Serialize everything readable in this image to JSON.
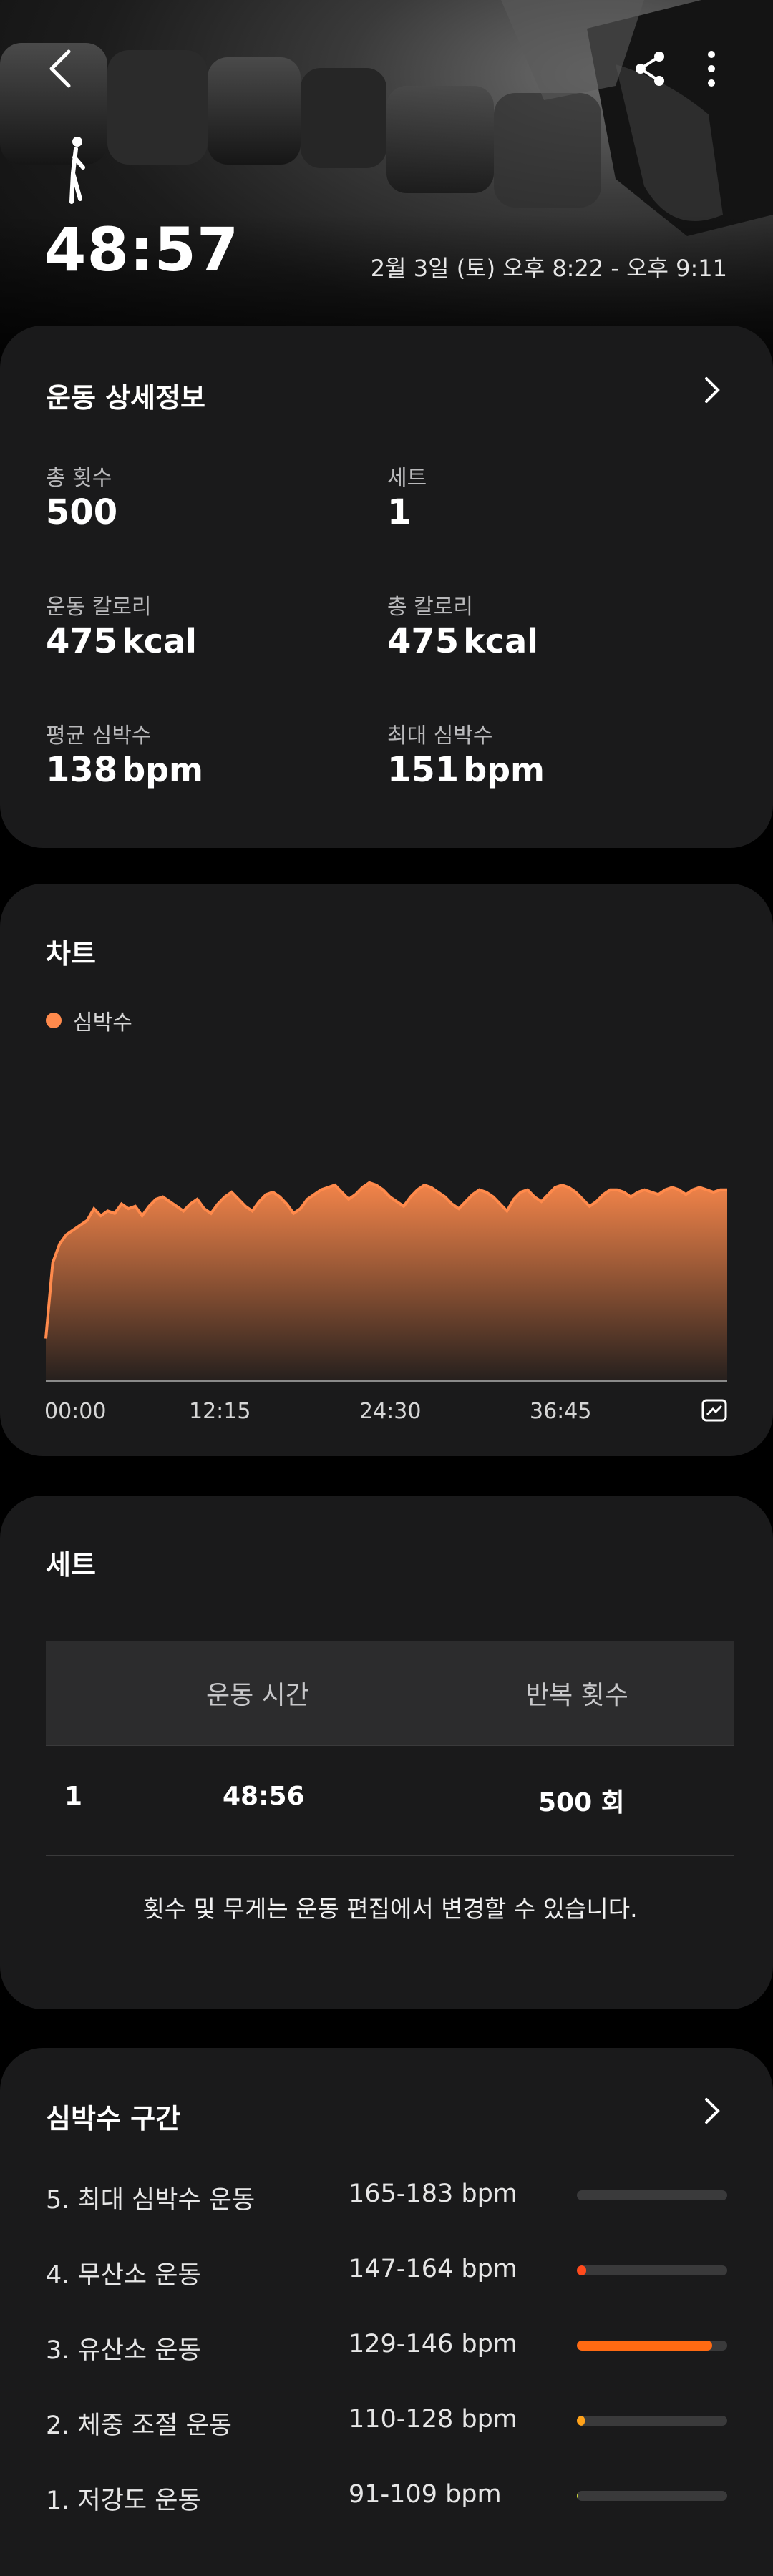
{
  "header": {
    "duration": "48:57",
    "datetime": "2월 3일 (토) 오후 8:22 - 오후 9:11",
    "icons": [
      "back-icon",
      "share-icon",
      "more-icon",
      "workout-icon"
    ]
  },
  "details": {
    "title": "운동 상세정보",
    "stats": [
      {
        "label": "총 횟수",
        "value": "500",
        "unit": ""
      },
      {
        "label": "세트",
        "value": "1",
        "unit": ""
      },
      {
        "label": "운동 칼로리",
        "value": "475",
        "unit": "kcal"
      },
      {
        "label": "총 칼로리",
        "value": "475",
        "unit": "kcal"
      },
      {
        "label": "평균 심박수",
        "value": "138",
        "unit": "bpm"
      },
      {
        "label": "최대 심박수",
        "value": "151",
        "unit": "bpm"
      }
    ]
  },
  "chart": {
    "title": "차트",
    "legend": "심박수",
    "color": "#ff8a4c"
  },
  "chart_data": {
    "type": "area",
    "series": [
      {
        "name": "심박수",
        "values": [
          78,
          110,
          118,
          122,
          124,
          126,
          128,
          133,
          130,
          132,
          131,
          135,
          133,
          134,
          130,
          134,
          137,
          138,
          136,
          134,
          132,
          135,
          137,
          133,
          131,
          135,
          138,
          140,
          137,
          134,
          132,
          136,
          139,
          140,
          138,
          135,
          131,
          133,
          137,
          139,
          141,
          142,
          143,
          140,
          137,
          139,
          142,
          144,
          143,
          141,
          138,
          136,
          134,
          138,
          141,
          143,
          142,
          140,
          138,
          135,
          133,
          136,
          139,
          141,
          140,
          138,
          135,
          132,
          137,
          140,
          141,
          138,
          136,
          139,
          142,
          143,
          142,
          140,
          137,
          134,
          136,
          139,
          141,
          141,
          140,
          138,
          140,
          141,
          140,
          139,
          141,
          142,
          141,
          139,
          141,
          142,
          141,
          140,
          141,
          141
        ]
      }
    ],
    "x_ticks": [
      "00:00",
      "12:15",
      "24:30",
      "36:45"
    ],
    "xlim": [
      0,
      48.95
    ],
    "ylim": [
      60,
      160
    ],
    "grid": false
  },
  "sets": {
    "title": "세트",
    "headers": [
      "운동 시간",
      "반복 횟수"
    ],
    "rows": [
      {
        "index": "1",
        "time": "48:56",
        "reps": "500 회"
      }
    ],
    "note": "횟수 및 무게는 운동 편집에서 변경할 수 있습니다."
  },
  "zones": {
    "title": "심박수 구간",
    "items": [
      {
        "label": "5. 최대 심박수 운동",
        "range": "165-183 bpm",
        "fraction": 0.0,
        "color": "#ff3b1f"
      },
      {
        "label": "4. 무산소 운동",
        "range": "147-164 bpm",
        "fraction": 0.06,
        "color": "#ff4a1c"
      },
      {
        "label": "3. 유산소 운동",
        "range": "129-146 bpm",
        "fraction": 0.9,
        "color": "#ff6a12"
      },
      {
        "label": "2. 체중 조절 운동",
        "range": "110-128 bpm",
        "fraction": 0.05,
        "color": "#ffa21a"
      },
      {
        "label": "1. 저강도 운동",
        "range": "91-109 bpm",
        "fraction": 0.01,
        "color": "#c9d43a"
      }
    ]
  }
}
